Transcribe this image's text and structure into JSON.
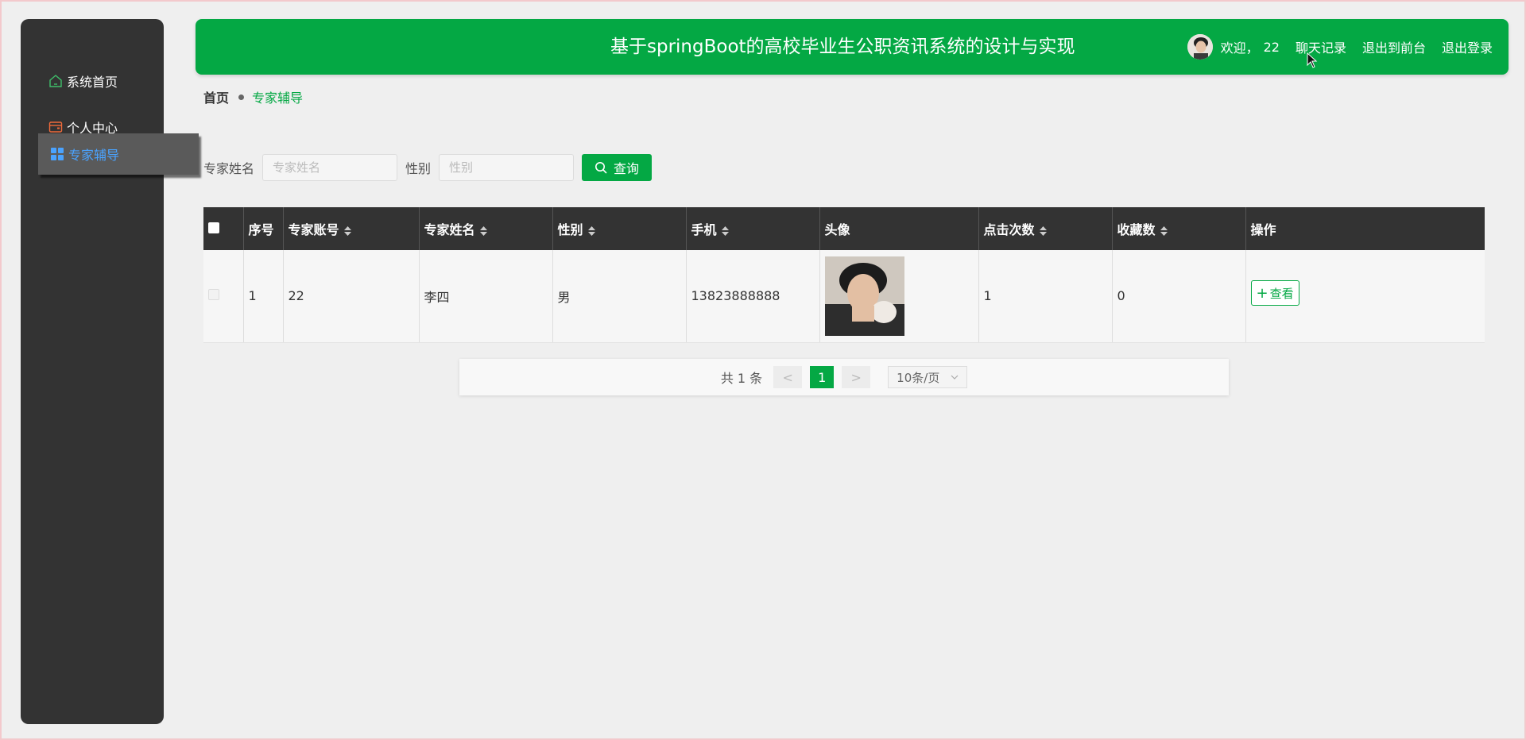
{
  "sidebar": {
    "items": [
      {
        "label": "系统首页",
        "icon": "home-icon"
      },
      {
        "label": "个人中心",
        "icon": "wallet-icon"
      },
      {
        "label": "专家辅导",
        "icon": "grid-icon"
      }
    ]
  },
  "header": {
    "title": "基于springBoot的高校毕业生公职资讯系统的设计与实现",
    "welcome_label": "欢迎，",
    "username": "22",
    "chat_record": "聊天记录",
    "exit_front": "退出到前台",
    "logout": "退出登录"
  },
  "breadcrumb": {
    "home": "首页",
    "current": "专家辅导"
  },
  "search": {
    "name_label": "专家姓名",
    "name_placeholder": "专家姓名",
    "gender_label": "性别",
    "gender_placeholder": "性别",
    "query_button": "查询"
  },
  "table": {
    "columns": {
      "index": "序号",
      "account": "专家账号",
      "name": "专家姓名",
      "gender": "性别",
      "phone": "手机",
      "avatar": "头像",
      "clicks": "点击次数",
      "favorites": "收藏数",
      "actions": "操作"
    },
    "rows": [
      {
        "index": "1",
        "account": "22",
        "name": "李四",
        "gender": "男",
        "phone": "13823888888",
        "clicks": "1",
        "favorites": "0",
        "view_label": "查看"
      }
    ]
  },
  "pagination": {
    "total": "共 1 条",
    "prev": "<",
    "page": "1",
    "next": ">",
    "page_size": "10条/页"
  },
  "colors": {
    "accent": "#04a844",
    "sidebar_bg": "#333333",
    "active_text": "#4aa3ff"
  }
}
